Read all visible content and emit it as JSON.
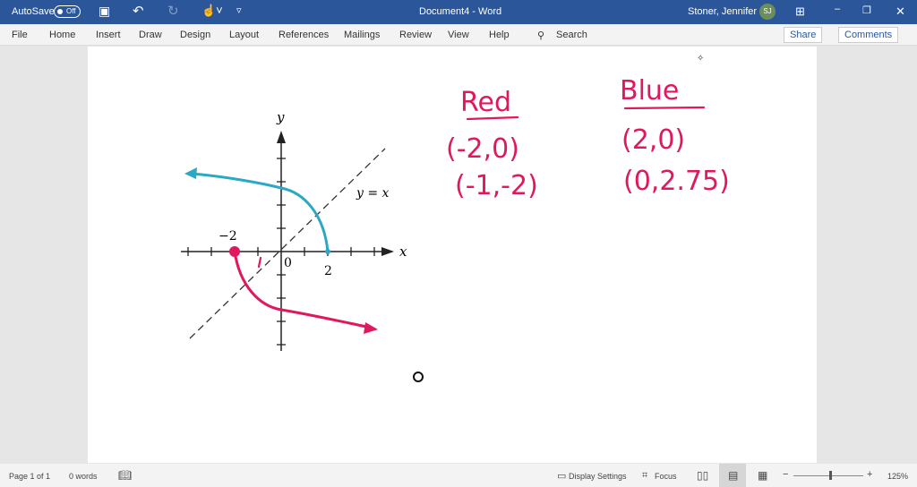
{
  "titlebar": {
    "autosave": "AutoSave",
    "autosave_state": "Off",
    "title": "Document4 - Word",
    "user": "Stoner, Jennifer L",
    "initials": "SJ"
  },
  "ribbon": {
    "tabs": [
      "File",
      "Home",
      "Insert",
      "Draw",
      "Design",
      "Layout",
      "References",
      "Mailings",
      "Review",
      "View",
      "Help"
    ],
    "search": "Search",
    "share": "Share",
    "comments": "Comments"
  },
  "graph": {
    "y_label": "y",
    "x_label": "x",
    "line_label": "y = x",
    "tick_neg2": "−2",
    "tick_0": "0",
    "tick_2": "2"
  },
  "notes": {
    "red_title": "Red",
    "red_p1": "(-2,0)",
    "red_p2": "(-1,-2)",
    "blue_title": "Blue",
    "blue_p1": "(2,0)",
    "blue_p2": "(0,2.75)"
  },
  "colors": {
    "red": "#e0185f",
    "blue": "#2aa8c4",
    "brand": "#2b579a"
  },
  "status": {
    "page": "Page 1 of 1",
    "words": "0 words",
    "display": "Display Settings",
    "focus": "Focus",
    "zoom": "125%"
  }
}
